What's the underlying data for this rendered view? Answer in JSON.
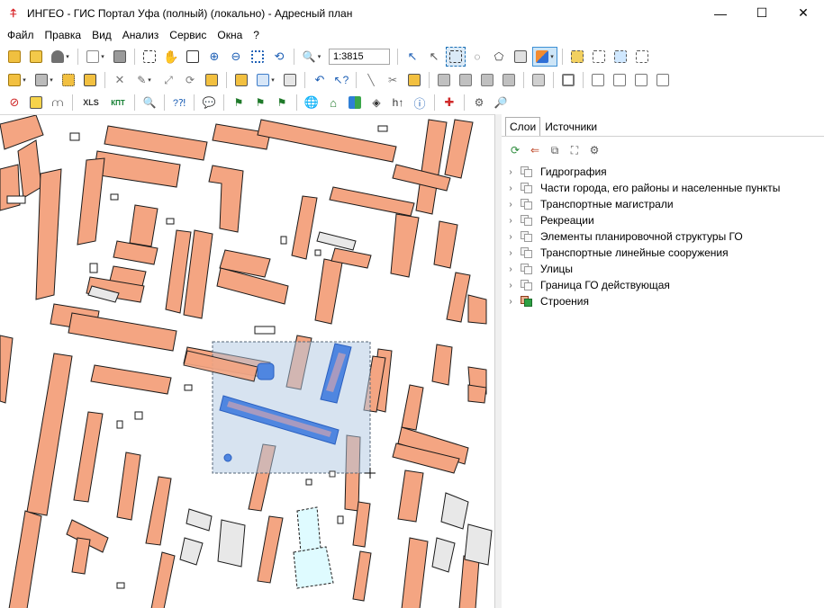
{
  "window": {
    "title": "ИНГЕО - ГИС Портал Уфа (полный) (локально) - Адресный план",
    "controls": {
      "minimize": "—",
      "maximize": "☐",
      "close": "✕"
    }
  },
  "menu": [
    "Файл",
    "Правка",
    "Вид",
    "Анализ",
    "Сервис",
    "Окна",
    "?"
  ],
  "toolbar": {
    "scale_value": "1:3815",
    "xls_label": "XLS",
    "kpt_label": "КПТ"
  },
  "panel": {
    "tabs": [
      "Слои",
      "Источники"
    ],
    "selected_tab": "Слои",
    "layers": [
      {
        "name": "Гидрография",
        "icon": "layer-stack-icon"
      },
      {
        "name": "Части города, его районы и населенные пункты",
        "icon": "layer-stack-icon"
      },
      {
        "name": "Транспортные магистрали",
        "icon": "layer-stack-icon"
      },
      {
        "name": "Рекреации",
        "icon": "layer-stack-icon"
      },
      {
        "name": "Элементы планировочной структуры ГО",
        "icon": "layer-stack-icon"
      },
      {
        "name": "Транспортные линейные сооружения",
        "icon": "layer-stack-icon"
      },
      {
        "name": "Улицы",
        "icon": "layer-stack-icon"
      },
      {
        "name": "Граница ГО действующая",
        "icon": "layer-stack-icon"
      },
      {
        "name": "Строения",
        "icon": "buildings-layer-icon"
      }
    ]
  },
  "colors": {
    "building_fill": "#f4a582",
    "building_stroke": "#1a1a1a",
    "selection_fill": "#b0c8e2",
    "selected_object": "#4f86e0",
    "grey_building": "#e8e8e8",
    "cyan_building": "#dffbff"
  }
}
